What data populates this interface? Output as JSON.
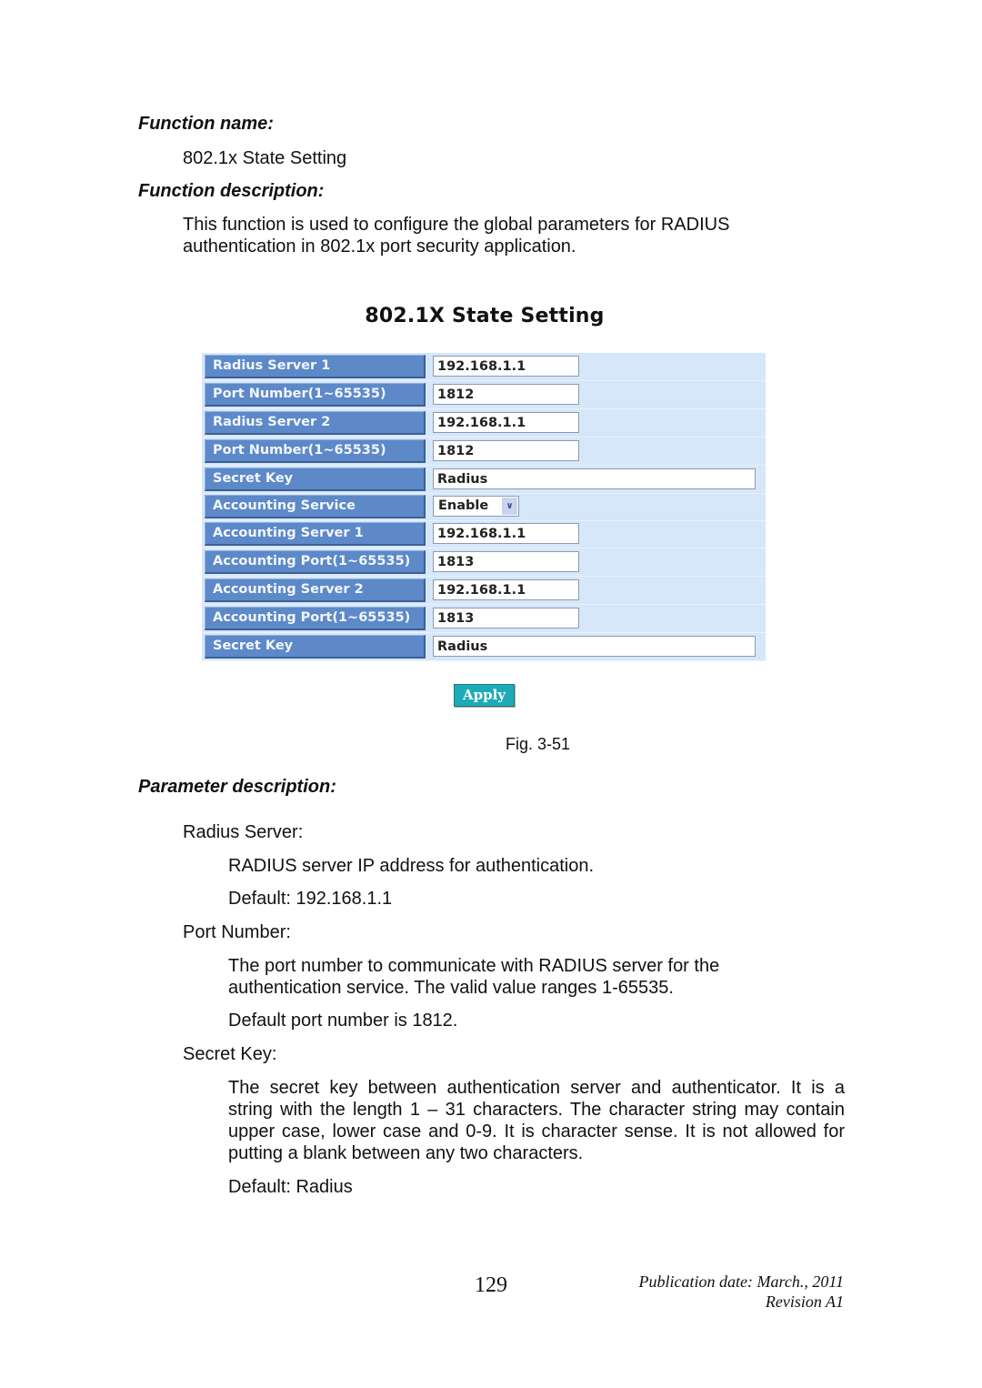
{
  "function_name": {
    "heading": "Function name:",
    "value": "802.1x State Setting"
  },
  "function_description": {
    "heading": "Function description:",
    "lines": [
      "This function is used to configure the global parameters for RADIUS",
      "authentication in 802.1x port security application."
    ]
  },
  "ui_panel": {
    "title": "802.1X State Setting",
    "rows": [
      {
        "label": "Radius Server 1",
        "type": "input",
        "value": "192.168.1.1",
        "size": "short"
      },
      {
        "label": "Port Number(1~65535)",
        "type": "input",
        "value": "1812",
        "size": "short"
      },
      {
        "label": "Radius Server 2",
        "type": "input",
        "value": "192.168.1.1",
        "size": "short"
      },
      {
        "label": "Port Number(1~65535)",
        "type": "input",
        "value": "1812",
        "size": "short"
      },
      {
        "label": "Secret Key",
        "type": "input",
        "value": "Radius",
        "size": "long"
      },
      {
        "label": "Accounting Service",
        "type": "select",
        "value": "Enable"
      },
      {
        "label": "Accounting Server 1",
        "type": "input",
        "value": "192.168.1.1",
        "size": "short"
      },
      {
        "label": "Accounting Port(1~65535)",
        "type": "input",
        "value": "1813",
        "size": "short"
      },
      {
        "label": "Accounting Server 2",
        "type": "input",
        "value": "192.168.1.1",
        "size": "short"
      },
      {
        "label": "Accounting Port(1~65535)",
        "type": "input",
        "value": "1813",
        "size": "short"
      },
      {
        "label": "Secret Key",
        "type": "input",
        "value": "Radius",
        "size": "long"
      }
    ],
    "apply_label": "Apply",
    "select_arrow_icon": "chevron-down-icon"
  },
  "figure_caption": "Fig. 3-51",
  "parameter_description": {
    "heading": "Parameter description:",
    "params": [
      {
        "name": "Radius Server:",
        "paragraphs": [
          [
            "RADIUS server IP address for authentication."
          ],
          [
            "Default: 192.168.1.1"
          ]
        ]
      },
      {
        "name": "Port Number:",
        "paragraphs": [
          [
            "The port number to communicate with RADIUS server for the",
            "authentication service. The valid value ranges 1-65535."
          ],
          [
            "Default port number is 1812."
          ]
        ]
      },
      {
        "name": "Secret Key:",
        "paragraphs": [
          [
            "The secret key between authentication server and authenticator. It is a",
            "string with the length 1 – 31 characters. The character string may contain",
            "upper case, lower case and 0-9. It is character sense. It is not allowed for",
            "putting a blank between any two characters."
          ],
          [
            "Default: Radius"
          ]
        ]
      }
    ]
  },
  "footer": {
    "page_number": "129",
    "publication_date": "Publication date: March., 2011",
    "revision": "Revision A1"
  },
  "colors": {
    "label_bg": "#5d89c8",
    "table_bg": "#d6e7fa",
    "apply_bg": "#1faab8"
  }
}
